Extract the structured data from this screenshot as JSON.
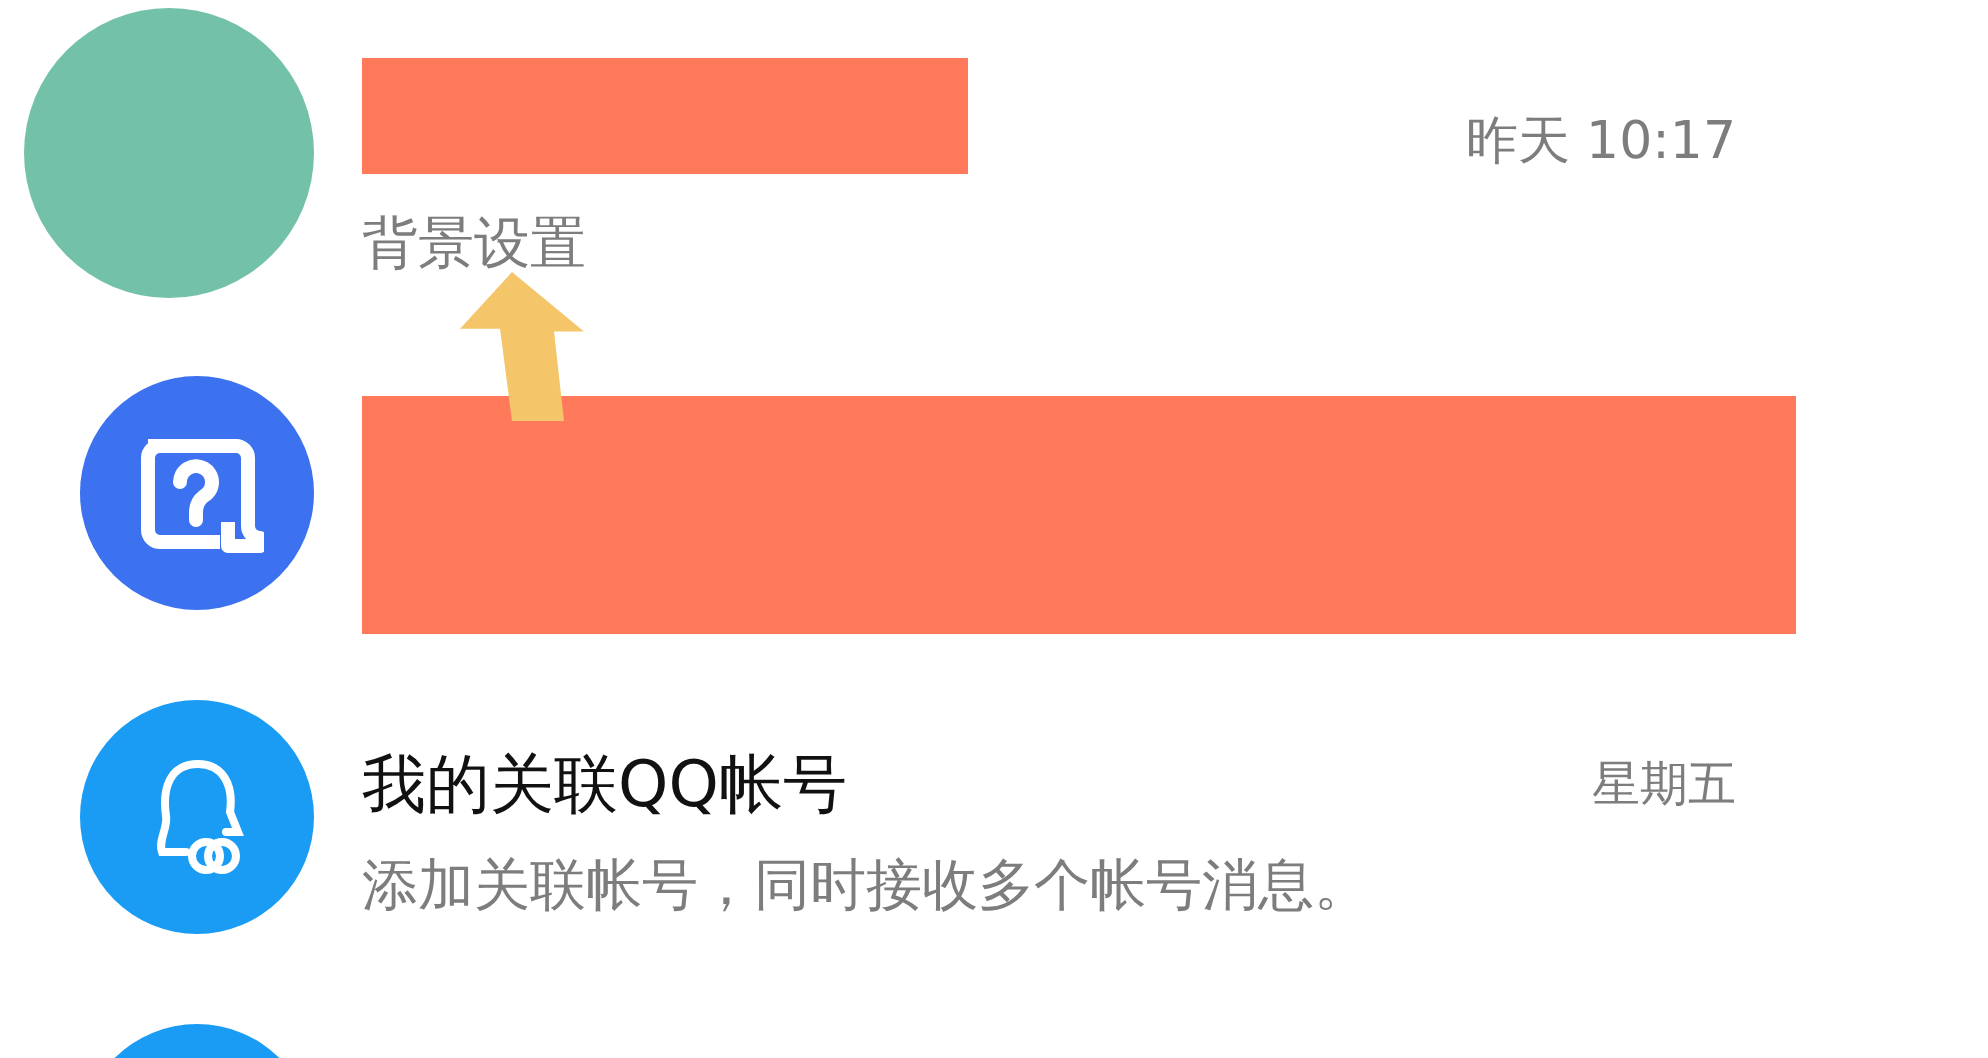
{
  "chats": [
    {
      "kind": "redacted-title",
      "avatar": {
        "kind": "plain",
        "color": "#74c1a9"
      },
      "time": "昨天 10:17",
      "preview": "背景设置"
    },
    {
      "kind": "redacted-all",
      "avatar": {
        "kind": "help",
        "color": "#3c72f0"
      }
    },
    {
      "kind": "normal",
      "avatar": {
        "kind": "linked",
        "color": "#1b9cf4"
      },
      "title": "我的关联QQ帐号",
      "time": "星期五",
      "preview": "添加关联帐号，同时接收多个帐号消息。"
    },
    {
      "kind": "cut",
      "avatar": {
        "kind": "plain",
        "color": "#1b9cf4"
      }
    }
  ],
  "annotation": {
    "kind": "arrow"
  }
}
